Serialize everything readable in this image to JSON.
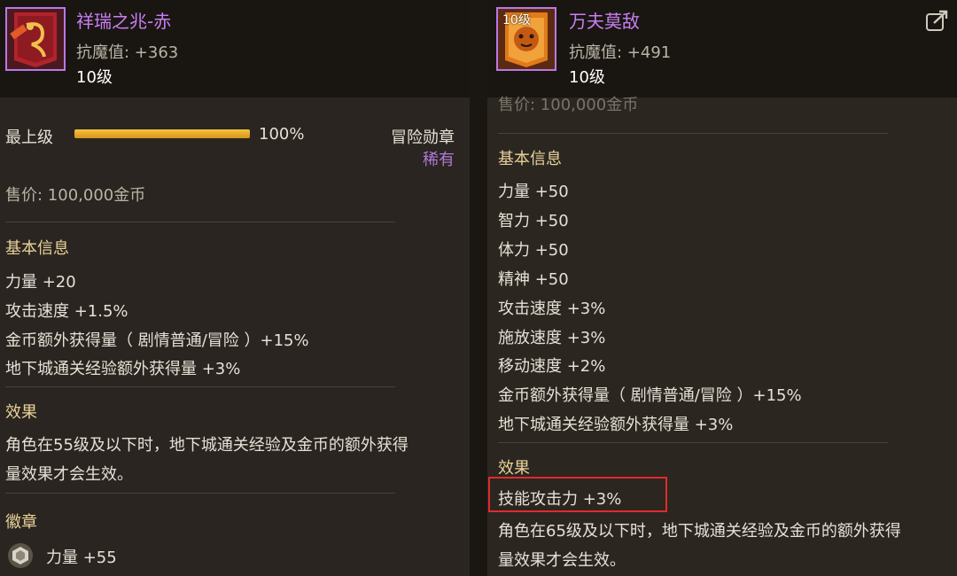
{
  "left": {
    "title": "祥瑞之兆-赤",
    "resist": "抗魔值: +363",
    "level": "10级",
    "max_label": "最上级",
    "progress": 1.0,
    "progress_text": "100%",
    "category": "冒险勋章",
    "rarity": "稀有",
    "price": "售价: 100,000金币",
    "basic_title": "基本信息",
    "stats": [
      "力量 +20",
      "攻击速度 +1.5%",
      "金币额外获得量（ 剧情普通/冒险 ）+15%",
      "地下城通关经验额外获得量 +3%"
    ],
    "effect_title": "效果",
    "effect_lines": [
      "角色在55级及以下时，地下城通关经验及金币的额外获得",
      "量效果才会生效。"
    ],
    "badge_title": "徽章",
    "badge_stat": "力量 +55"
  },
  "right": {
    "title": "万夫莫敌",
    "resist": "抗魔值: +491",
    "level": "10级",
    "thumb_level": "10级",
    "price_partial": "售价: 100,000金币",
    "basic_title": "基本信息",
    "stats": [
      "力量 +50",
      "智力 +50",
      "体力 +50",
      "精神 +50",
      "攻击速度 +3%",
      "施放速度 +3%",
      "移动速度 +2%",
      "金币额外获得量（ 剧情普通/冒险 ）+15%",
      "地下城通关经验额外获得量 +3%"
    ],
    "effect_title": "效果",
    "highlight_stat": "技能攻击力 +3%",
    "effect_lines": [
      "角色在65级及以下时，地下城通关经验及金币的额外获得",
      "量效果才会生效。"
    ]
  },
  "colors": {
    "title": "#c97ef2",
    "section": "#e8d29a",
    "rarity": "#b07ad8",
    "highlight_border": "#e02b2b",
    "progress": "#f0b830"
  },
  "icons": {
    "left_item": "red-dragon-banner-icon",
    "right_item": "tiger-banner-icon",
    "badge": "gem-badge-icon",
    "share": "share-icon"
  }
}
